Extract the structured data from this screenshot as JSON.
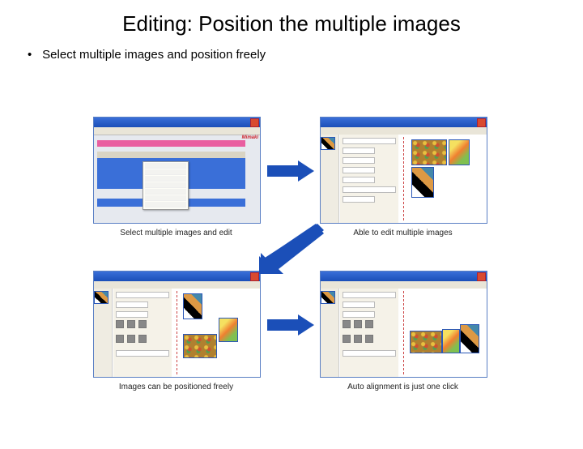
{
  "title": "Editing: Position the multiple images",
  "bullet": "Select multiple images and position freely",
  "brand": "Mimaki",
  "captions": {
    "c1": "Select multiple images and edit",
    "c2": "Able to edit multiple images",
    "c3": "Images can be positioned freely",
    "c4": "Auto alignment is just one click"
  }
}
